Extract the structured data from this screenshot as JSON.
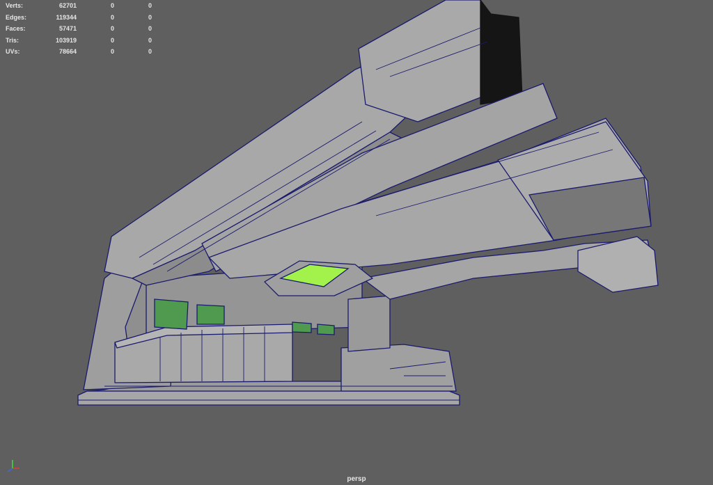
{
  "viewport": {
    "camera_name": "persp",
    "background_color": "#5f5f5f"
  },
  "heads_up_display": {
    "rows": [
      {
        "label": "Verts:",
        "values": [
          "62701",
          "0",
          "0"
        ]
      },
      {
        "label": "Edges:",
        "values": [
          "119344",
          "0",
          "0"
        ]
      },
      {
        "label": "Faces:",
        "values": [
          "57471",
          "0",
          "0"
        ]
      },
      {
        "label": "Tris:",
        "values": [
          "103919",
          "0",
          "0"
        ]
      },
      {
        "label": "UVs:",
        "values": [
          "78664",
          "0",
          "0"
        ]
      }
    ]
  },
  "scene": {
    "model_fill": "#a6a6a6",
    "model_shadow": "#7a7a7a",
    "wireframe_color": "#1a1a6e",
    "screen_color": "#4f9a4f",
    "light_panel_color": "#a3f24b"
  },
  "axis_gizmo": {
    "icon": "view-axis-icon",
    "x_color": "#e23a3a",
    "y_color": "#3ae23a",
    "z_color": "#3a6ae2"
  }
}
